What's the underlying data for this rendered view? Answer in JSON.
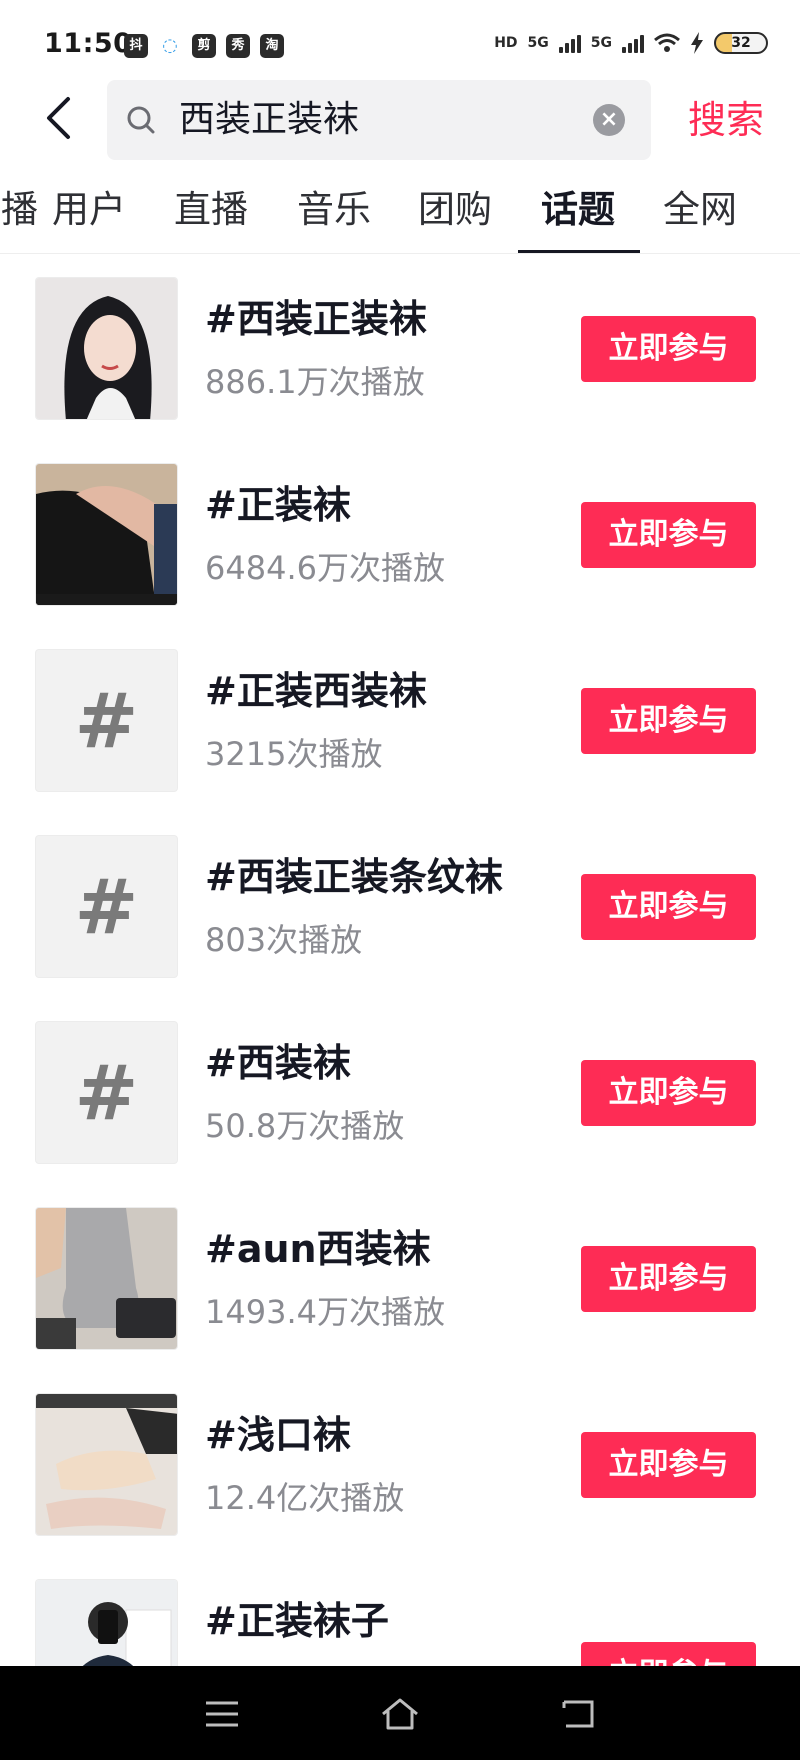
{
  "status_bar": {
    "time": "11:50",
    "app_icons": [
      "抖",
      "◌",
      "剪",
      "秀",
      "淘"
    ],
    "hd": "HD",
    "network_1": "5G",
    "network_2": "5G",
    "battery": "32"
  },
  "search": {
    "query": "西装正装袜",
    "button_label": "搜索"
  },
  "tabs": [
    {
      "label": "直播"
    },
    {
      "label": "用户"
    },
    {
      "label": "直播"
    },
    {
      "label": "音乐"
    },
    {
      "label": "团购"
    },
    {
      "label": "话题"
    },
    {
      "label": "全网"
    }
  ],
  "active_tab": "话题",
  "topics": [
    {
      "title": "#西装正装袜",
      "plays": "886.1万次播放",
      "button": "立即参与",
      "thumb": "photo-portrait"
    },
    {
      "title": "#正装袜",
      "plays": "6484.6万次播放",
      "button": "立即参与",
      "thumb": "photo-socks-dark"
    },
    {
      "title": "#正装西装袜",
      "plays": "3215次播放",
      "button": "立即参与",
      "thumb": "#"
    },
    {
      "title": "#西装正装条纹袜",
      "plays": "803次播放",
      "button": "立即参与",
      "thumb": "#"
    },
    {
      "title": "#西装袜",
      "plays": "50.8万次播放",
      "button": "立即参与",
      "thumb": "#"
    },
    {
      "title": "#aun西装袜",
      "plays": "1493.4万次播放",
      "button": "立即参与",
      "thumb": "photo-socks-grey"
    },
    {
      "title": "#浅口袜",
      "plays": "12.4亿次播放",
      "button": "立即参与",
      "thumb": "photo-socks-low"
    },
    {
      "title": "#正装袜子",
      "plays": "",
      "button": "立即参与",
      "thumb": "photo-person"
    }
  ],
  "colors": {
    "accent": "#fe2c55",
    "text_primary": "#161823",
    "text_secondary": "#8a8b91"
  }
}
